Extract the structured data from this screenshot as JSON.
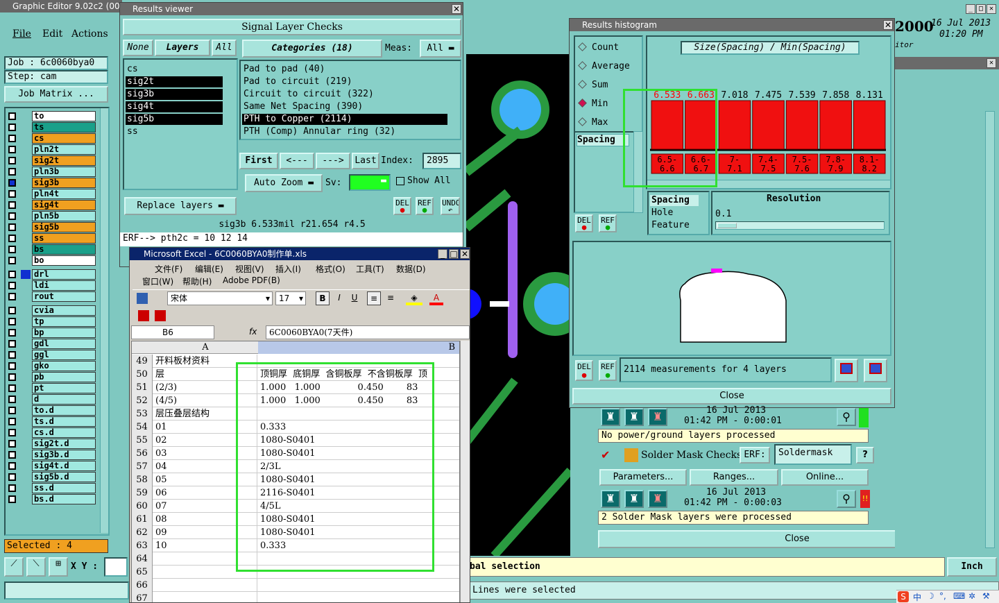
{
  "main_window": {
    "title": "Graphic Editor 9.02c2 (00",
    "menu": [
      "File",
      "Edit",
      "Actions"
    ],
    "job_label": "Job : 6c0060bya0",
    "step_label": "Step: cam",
    "job_matrix_button": "Job Matrix ...",
    "layers": [
      "to",
      "ts",
      "cs",
      "pln2t",
      "sig2t",
      "pln3b",
      "sig3b",
      "pln4t",
      "sig4t",
      "pln5b",
      "sig5b",
      "ss",
      "bs",
      "bo",
      "drl",
      "ldi",
      "rout",
      "cvia",
      "tp",
      "bp",
      "gdl",
      "ggl",
      "gko",
      "pb",
      "pt",
      "d",
      "to.d",
      "ts.d",
      "cs.d",
      "sig2t.d",
      "sig3b.d",
      "sig4t.d",
      "sig5b.d",
      "ss.d",
      "bs.d"
    ],
    "selected_count": "Selected : 4",
    "xy_label": "X Y :",
    "status_text_1": "bal selection",
    "status_text_2": "Lines were selected",
    "units": "Inch",
    "clock_year": "2000",
    "clock_date": "16 Jul 2013",
    "clock_time": "01:20 PM",
    "clock_sub": "itor"
  },
  "results_viewer": {
    "title": "Results viewer",
    "header": "Signal Layer Checks",
    "btn_none": "None",
    "btn_layers": "Layers",
    "btn_all": "All",
    "layer_list": [
      "cs",
      "sig2t",
      "sig3b",
      "sig4t",
      "sig5b",
      "ss"
    ],
    "categories_label": "Categories (18)",
    "meas_label": "Meas:",
    "meas_value": "All",
    "categories": [
      "Pad to pad (40)",
      "Pad to circuit (219)",
      "Circuit to circuit (322)",
      "Same Net Spacing (390)",
      "PTH to Copper (2114)",
      "PTH (Comp) Annular ring (32)"
    ],
    "nav": {
      "first": "First",
      "prev": "<---",
      "next": "--->",
      "last": "Last",
      "index_label": "Index:",
      "index_value": "2895"
    },
    "auto_zoom": "Auto Zoom",
    "sv_label": "Sv:",
    "show_all": "Show All",
    "replace_layers": "Replace layers",
    "icon_del": "DEL",
    "icon_ref": "REF",
    "icon_undo": "UNDO",
    "status": "sig3b 6.533mil  r21.654  r4.5",
    "erf_line": "ERF--> pth2c = 10 12 14"
  },
  "excel": {
    "title": "Microsoft Excel - 6C0060BYA0制作单.xls",
    "menu1": [
      "文件(F)",
      "编辑(E)",
      "视图(V)",
      "插入(I)",
      "格式(O)",
      "工具(T)",
      "数据(D)"
    ],
    "menu2": [
      "窗口(W)",
      "帮助(H)",
      "Adobe PDF(B)"
    ],
    "font_name": "宋体",
    "font_size": "17",
    "name_box": "B6",
    "fx": "fx",
    "formula": "6C0060BYA0(7天件)",
    "col_a": "A",
    "col_b": "B",
    "rows": [
      {
        "n": "49",
        "a": "开料板材资料",
        "b": ""
      },
      {
        "n": "50",
        "a": "层",
        "b": "顶铜厚  底铜厚  含铜板厚  不含铜板厚  顶"
      },
      {
        "n": "51",
        "a": "(2/3)",
        "b": "1.000   1.000             0.450        83"
      },
      {
        "n": "52",
        "a": "(4/5)",
        "b": "1.000   1.000             0.450        83"
      },
      {
        "n": "53",
        "a": "层压叠层结构",
        "b": ""
      },
      {
        "n": "54",
        "a": "01",
        "b": "0.333"
      },
      {
        "n": "55",
        "a": "02",
        "b": "1080-S0401"
      },
      {
        "n": "56",
        "a": "03",
        "b": "1080-S0401"
      },
      {
        "n": "57",
        "a": "04",
        "b": "2/3L"
      },
      {
        "n": "58",
        "a": "05",
        "b": "1080-S0401"
      },
      {
        "n": "59",
        "a": "06",
        "b": "2116-S0401"
      },
      {
        "n": "60",
        "a": "07",
        "b": "4/5L"
      },
      {
        "n": "61",
        "a": "08",
        "b": "1080-S0401"
      },
      {
        "n": "62",
        "a": "09",
        "b": "1080-S0401"
      },
      {
        "n": "63",
        "a": "10",
        "b": "0.333"
      },
      {
        "n": "64",
        "a": "",
        "b": ""
      },
      {
        "n": "65",
        "a": "",
        "b": ""
      },
      {
        "n": "66",
        "a": "",
        "b": ""
      },
      {
        "n": "67",
        "a": "",
        "b": ""
      }
    ]
  },
  "histogram": {
    "title": "Results histogram",
    "options": [
      "Count",
      "Average",
      "Sum",
      "Min",
      "Max"
    ],
    "selected_option": "Min",
    "chart_title": "Size(Spacing) / Min(Spacing)",
    "metric_label": "Spacing",
    "resolution_label": "Resolution",
    "resolution_value": "0.1",
    "feature_types": [
      "Spacing",
      "Hole",
      "Feature"
    ],
    "measurements_text": "2114 measurements for 4 layers",
    "close": "Close",
    "icon_del": "DEL",
    "icon_ref": "REF"
  },
  "chart_data": {
    "type": "bar",
    "title": "Size(Spacing) / Min(Spacing)",
    "categories": [
      "6.5-\n6.6",
      "6.6-\n6.7",
      "7-\n7.1",
      "7.4-\n7.5",
      "7.5-\n7.6",
      "7.8-\n7.9",
      "8.1-\n8.2"
    ],
    "values": [
      6.533,
      6.663,
      7.018,
      7.475,
      7.539,
      7.858,
      8.131
    ],
    "value_labels": [
      "6.533",
      "6.663",
      "7.018",
      "7.475",
      "7.539",
      "7.858",
      "8.131"
    ],
    "highlight_colors": [
      "#ff0000",
      "#ff0000",
      "#000000",
      "#000000",
      "#000000",
      "#000000",
      "#000000"
    ],
    "bar_color": "#f01010"
  },
  "checks_panel": {
    "date1": "16 Jul 2013",
    "time1": "01:42 PM - 0:00:01",
    "msg1": "No power/ground layers processed",
    "solder_title": "Solder Mask Checks",
    "erf_label": "ERF:",
    "erf_value": "Soldermask",
    "help": "?",
    "parameters": "Parameters...",
    "ranges": "Ranges...",
    "online": "Online...",
    "date2": "16 Jul 2013",
    "time2": "01:42 PM - 0:00:03",
    "msg2": "2 Solder Mask layers were processed",
    "close": "Close"
  },
  "taskbar": {
    "ime": "中"
  }
}
